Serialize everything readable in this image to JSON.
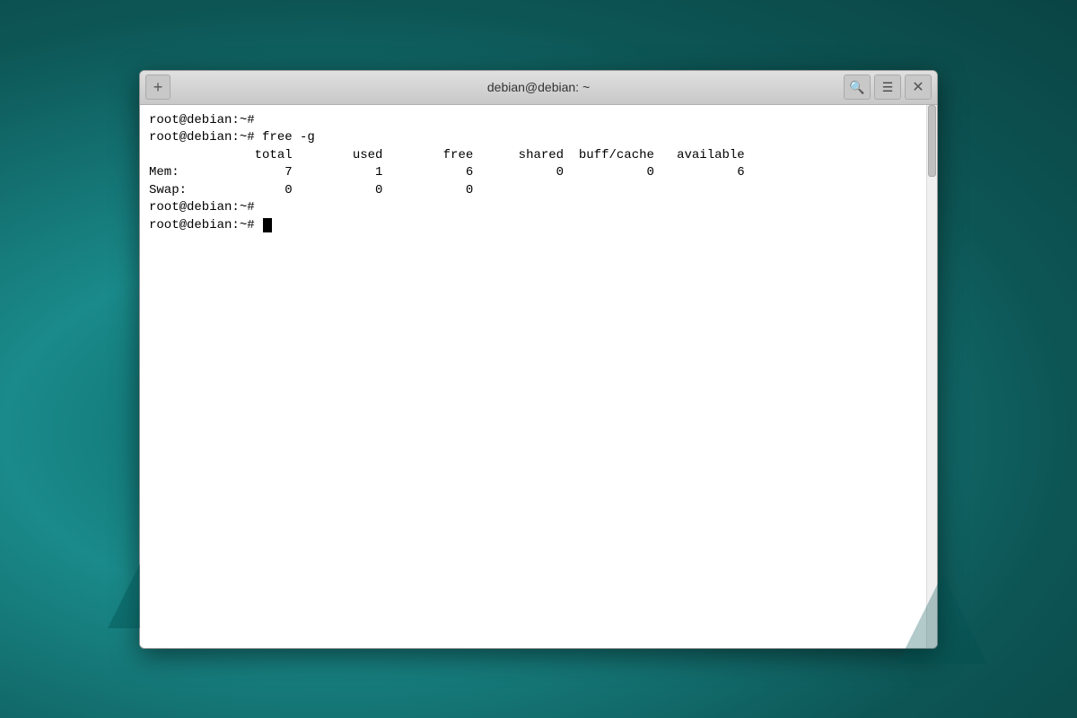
{
  "titleBar": {
    "title": "debian@debian: ~",
    "newTabLabel": "+",
    "searchIcon": "🔍",
    "menuIcon": "≡",
    "closeIcon": "×"
  },
  "terminal": {
    "lines": [
      {
        "text": "root@debian:~#",
        "type": "prompt"
      },
      {
        "text": "root@debian:~# free -g",
        "type": "command"
      },
      {
        "text": "              total        used        free      shared  buff/cache   available",
        "type": "output"
      },
      {
        "text": "Mem:              7           1           6           0           0           6",
        "type": "output"
      },
      {
        "text": "Swap:             0           0           0",
        "type": "output"
      },
      {
        "text": "root@debian:~#",
        "type": "prompt"
      },
      {
        "text": "root@debian:~# ",
        "type": "prompt-active"
      }
    ]
  }
}
